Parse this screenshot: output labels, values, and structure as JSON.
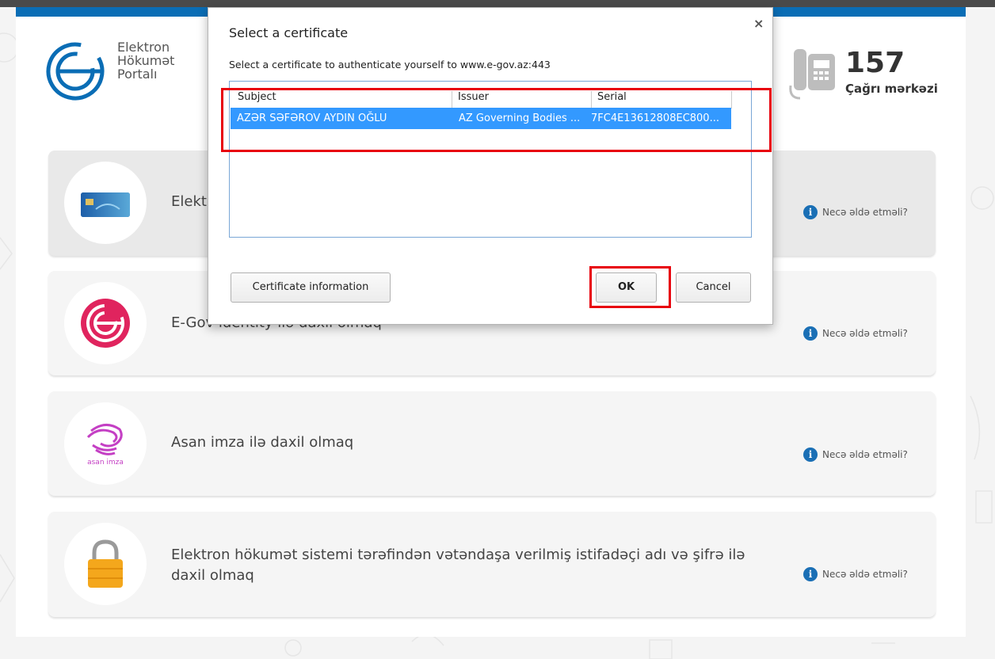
{
  "portal": {
    "logo_line1": "Elektron",
    "logo_line2": "Hökumət",
    "logo_line3": "Portalı",
    "call_number": "157",
    "call_label": "Çağrı mərkəzi"
  },
  "options": [
    {
      "text": "Elekt",
      "help": "Necə əldə etməli?",
      "icon": "id-card-icon"
    },
    {
      "text": "E-Gov identity ilə daxil olmaq",
      "help": "Necə əldə etməli?",
      "icon": "egov-logo-icon"
    },
    {
      "text": "Asan imza ilə daxil olmaq",
      "help": "Necə əldə etməli?",
      "icon": "asan-imza-icon",
      "icon_label": "asan imza"
    },
    {
      "text": "Elektron hökumət sistemi tərəfindən vətəndaşa verilmiş istifadəçi adı və şifrə ilə daxil olmaq",
      "help": "Necə əldə etməli?",
      "icon": "padlock-icon"
    }
  ],
  "dialog": {
    "title": "Select a certificate",
    "subtitle": "Select a certificate to authenticate yourself to www.e-gov.az:443",
    "close": "×",
    "columns": [
      "Subject",
      "Issuer",
      "Serial"
    ],
    "rows": [
      {
        "subject": "AZƏR SƏFƏROV AYDIN OĞLU",
        "issuer": "AZ Governing Bodies ...",
        "serial": "7FC4E13612808EC800..."
      }
    ],
    "cert_info_button": "Certificate information",
    "ok_button": "OK",
    "cancel_button": "Cancel"
  },
  "colors": {
    "accent": "#0a6db5",
    "selection": "#3399ff",
    "highlight": "#e8000b"
  }
}
